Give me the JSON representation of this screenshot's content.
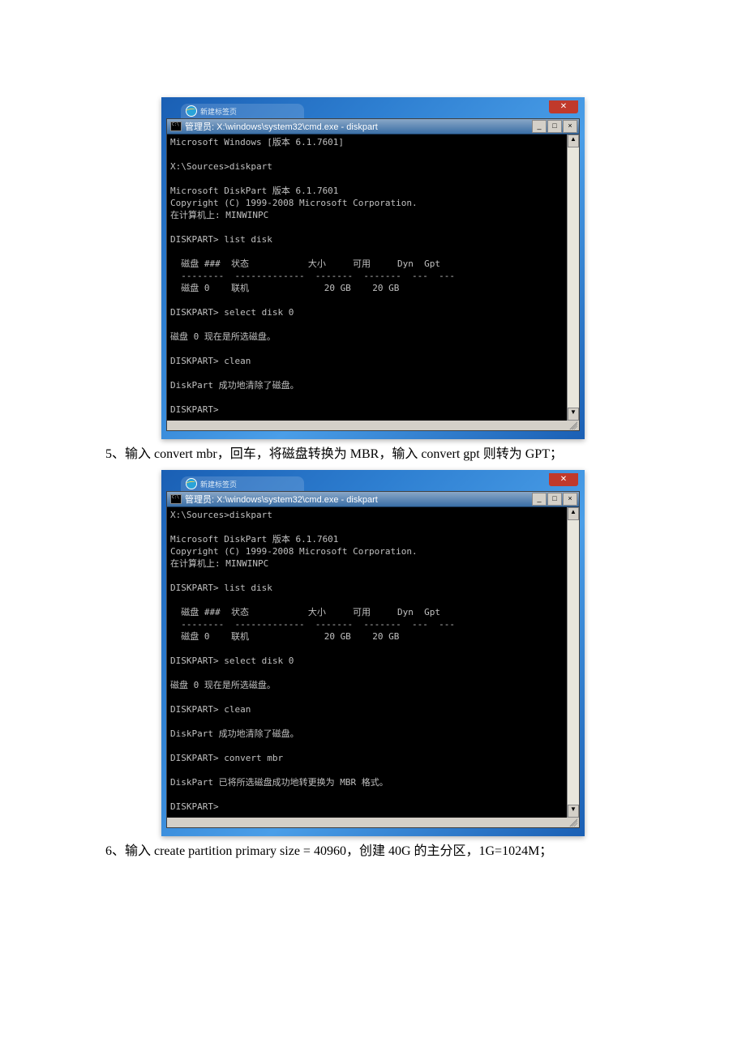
{
  "step5": {
    "text": "5、输入 convert mbr，回车，将磁盘转换为 MBR，输入 convert gpt 则转为 GPT；"
  },
  "step6": {
    "text": "6、输入 create partition primary size = 40960，创建 40G 的主分区，1G=1024M；"
  },
  "outer_window": {
    "close_label": "✕",
    "tab_text": "新建标签页"
  },
  "cmd_common": {
    "title": "管理员: X:\\windows\\system32\\cmd.exe - diskpart",
    "min_label": "_",
    "max_label": "□",
    "close_label": "×",
    "scroll_up": "▲",
    "scroll_down": "▼"
  },
  "terminal1": {
    "lines": [
      "Microsoft Windows [版本 6.1.7601]",
      "",
      "X:\\Sources>diskpart",
      "",
      "Microsoft DiskPart 版本 6.1.7601",
      "Copyright (C) 1999-2008 Microsoft Corporation.",
      "在计算机上: MINWINPC",
      "",
      "DISKPART> list disk",
      "",
      "  磁盘 ###  状态           大小     可用     Dyn  Gpt",
      "  --------  -------------  -------  -------  ---  ---",
      "  磁盘 0    联机              20 GB    20 GB",
      "",
      "DISKPART> select disk 0",
      "",
      "磁盘 0 现在是所选磁盘。",
      "",
      "DISKPART> clean",
      "",
      "DiskPart 成功地清除了磁盘。",
      "",
      "DISKPART>"
    ]
  },
  "terminal2": {
    "lines": [
      "X:\\Sources>diskpart",
      "",
      "Microsoft DiskPart 版本 6.1.7601",
      "Copyright (C) 1999-2008 Microsoft Corporation.",
      "在计算机上: MINWINPC",
      "",
      "DISKPART> list disk",
      "",
      "  磁盘 ###  状态           大小     可用     Dyn  Gpt",
      "  --------  -------------  -------  -------  ---  ---",
      "  磁盘 0    联机              20 GB    20 GB",
      "",
      "DISKPART> select disk 0",
      "",
      "磁盘 0 现在是所选磁盘。",
      "",
      "DISKPART> clean",
      "",
      "DiskPart 成功地清除了磁盘。",
      "",
      "DISKPART> convert mbr",
      "",
      "DiskPart 已将所选磁盘成功地转更换为 MBR 格式。",
      "",
      "DISKPART>"
    ]
  }
}
